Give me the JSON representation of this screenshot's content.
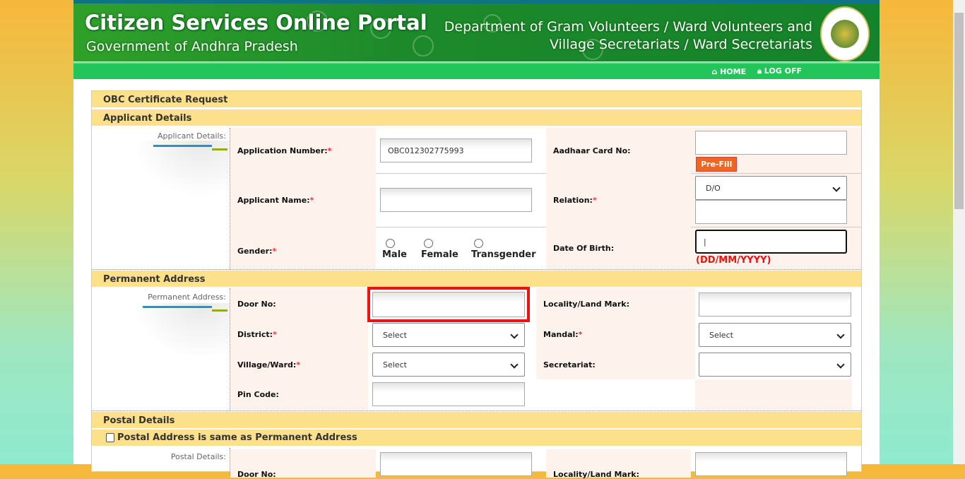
{
  "header": {
    "title": "Citizen Services Online Portal",
    "subtitle": "Government of Andhra Pradesh",
    "department_line1": "Department of Gram Volunteers / Ward Volunteers and",
    "department_line2": "Village Secretariats / Ward Secretariats"
  },
  "nav": {
    "home": "HOME",
    "logoff": "LOG OFF"
  },
  "form": {
    "title": "OBC Certificate Request",
    "applicant": {
      "section": "Applicant Details",
      "side_label": "Applicant Details:",
      "application_number_label": "Application Number:",
      "application_number_value": "OBC012302775993",
      "aadhaar_label": "Aadhaar Card No:",
      "aadhaar_value": "",
      "prefill": "Pre-Fill",
      "applicant_name_label": "Applicant Name:",
      "applicant_name_value": "",
      "relation_label": "Relation:",
      "relation_value": "D/O",
      "gender_label": "Gender:",
      "gender_options": [
        "Male",
        "Female",
        "Transgender"
      ],
      "dob_label": "Date Of Birth:",
      "dob_hint": "(DD/MM/YYYY)"
    },
    "permanent": {
      "section": "Permanent Address",
      "side_label": "Permanent Address:",
      "door_label": "Door No:",
      "locality_label": "Locality/Land Mark:",
      "district_label": "District:",
      "district_value": "Select",
      "mandal_label": "Mandal:",
      "mandal_value": "Select",
      "village_label": "Village/Ward:",
      "village_value": "Select",
      "secretariat_label": "Secretariat:",
      "secretariat_value": "",
      "pin_label": "Pin Code:"
    },
    "postal": {
      "section": "Postal Details",
      "same_as_label": "Postal Address is same as Permanent Address",
      "side_label": "Postal Details:",
      "door_label": "Door No:",
      "locality_label": "Locality/Land Mark:"
    },
    "required_mark": "*"
  },
  "colors": {
    "highlight": "#ee1111",
    "prefill_bg": "#ee6622",
    "hint": "#ee1111"
  }
}
